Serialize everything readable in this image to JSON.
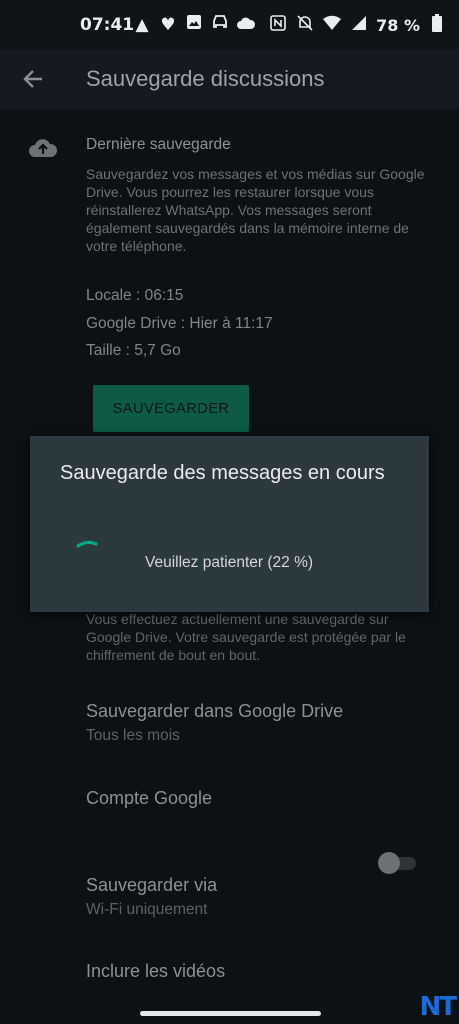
{
  "status_bar": {
    "time": "07:41",
    "battery": "78 %",
    "left_icons": [
      "navigation-arrow-icon",
      "heart-icon",
      "gallery-icon",
      "car-icon",
      "cloud-icon"
    ],
    "right_icons": [
      "nfc-icon",
      "mute-icon",
      "wifi-icon",
      "signal-icon",
      "battery-icon"
    ]
  },
  "toolbar": {
    "title": "Sauvegarde discussions",
    "back_icon": "arrow-left-icon"
  },
  "section": {
    "heading": "Dernière sauvegarde",
    "description": "Sauvegardez vos messages et vos médias sur Google Drive. Vous pourrez les restaurer lorsque vous réinstallerez WhatsApp. Vos messages seront également sauvegardés dans la mémoire interne de votre téléphone.",
    "local": "Locale : 06:15",
    "google_drive": "Google Drive : Hier à 11:17",
    "size": "Taille : 5,7 Go",
    "save_button": "SAUVEGARDER",
    "encryption_note": "Vous effectuez actuellement une sauvegarde sur Google Drive. Votre sauvegarde est protégée par le chiffrement de bout en bout."
  },
  "settings": [
    {
      "title": "Sauvegarder dans Google Drive",
      "subtitle": "Tous les mois"
    },
    {
      "title": "Compte Google",
      "subtitle": ""
    },
    {
      "title": "Sauvegarder via",
      "subtitle": "Wi-Fi uniquement"
    },
    {
      "title": "Inclure les vidéos",
      "subtitle": ""
    }
  ],
  "include_videos_enabled": false,
  "dialog": {
    "title": "Sauvegarde des messages en cours",
    "message": "Veuillez patienter (22 %)",
    "progress_percent": 22
  },
  "watermark": "NT",
  "colors": {
    "accent": "#00a884",
    "background": "#0b1014",
    "dialog": "#2b3a41"
  }
}
